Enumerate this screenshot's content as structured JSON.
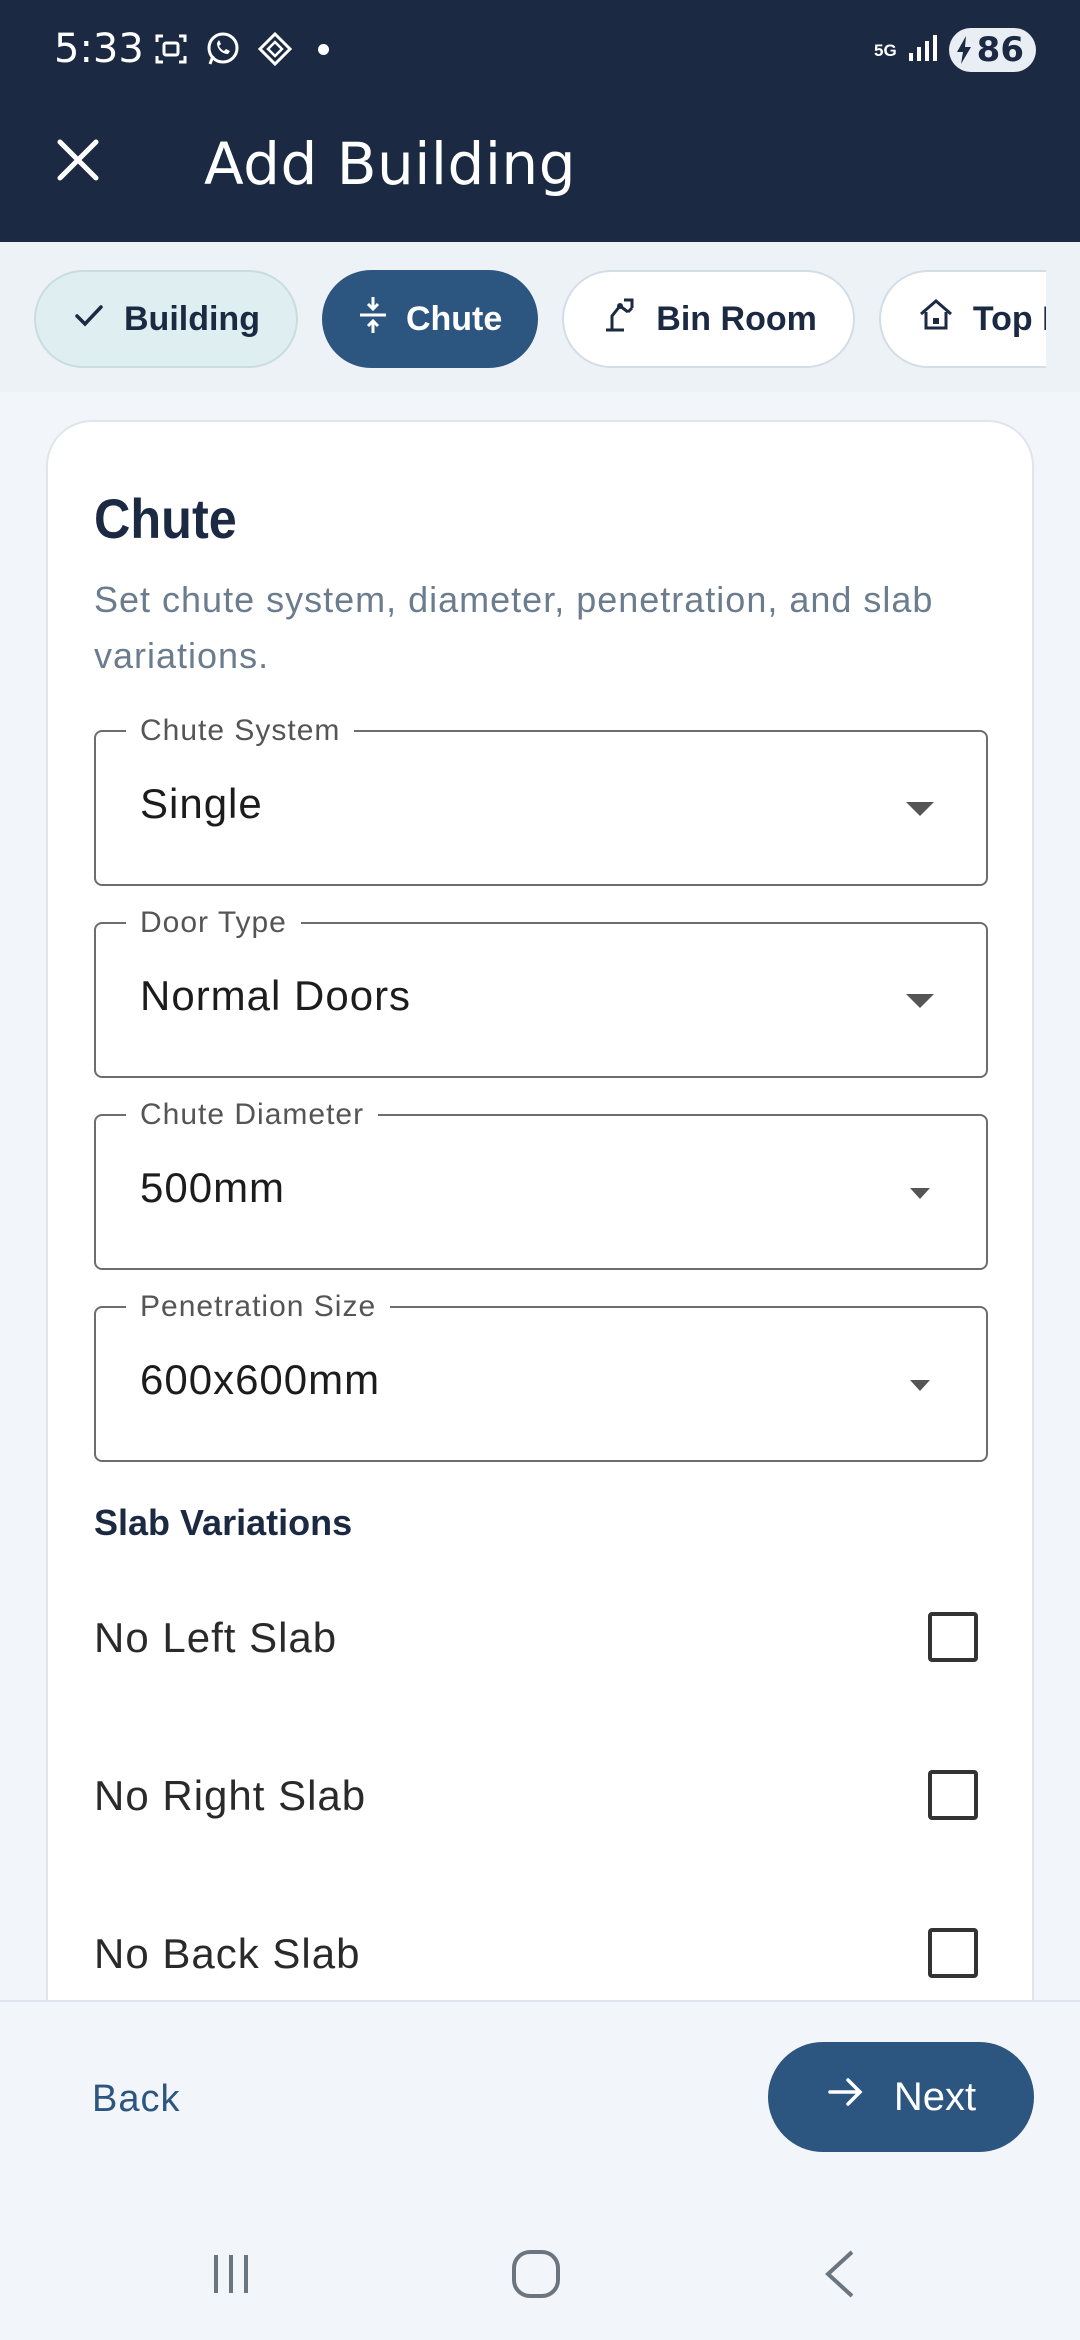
{
  "status_bar": {
    "time": "5:33",
    "network": "5G",
    "battery": "86"
  },
  "app_bar": {
    "title": "Add Building",
    "close_icon": "close-icon"
  },
  "steps": [
    {
      "label": "Building",
      "icon": "check-icon",
      "state": "done"
    },
    {
      "label": "Chute",
      "icon": "compress-icon",
      "state": "active"
    },
    {
      "label": "Bin Room",
      "icon": "bin-room-icon",
      "state": "idle"
    },
    {
      "label": "Top F",
      "icon": "home-icon",
      "state": "idle"
    }
  ],
  "section": {
    "title": "Chute",
    "description": "Set chute system, diameter, penetration, and slab variations."
  },
  "fields": {
    "chute_system": {
      "label": "Chute System",
      "value": "Single"
    },
    "door_type": {
      "label": "Door Type",
      "value": "Normal Doors"
    },
    "chute_diameter": {
      "label": "Chute Diameter",
      "value": "500mm"
    },
    "penetration_size": {
      "label": "Penetration Size",
      "value": "600x600mm"
    }
  },
  "slab": {
    "heading": "Slab Variations",
    "options": [
      {
        "label": "No Left Slab",
        "checked": false
      },
      {
        "label": "No Right Slab",
        "checked": false
      },
      {
        "label": "No Back Slab",
        "checked": false
      }
    ]
  },
  "actions": {
    "back_label": "Back",
    "next_label": "Next"
  },
  "colors": {
    "primary": "#2c5580",
    "app_bar": "#1b2a42"
  }
}
